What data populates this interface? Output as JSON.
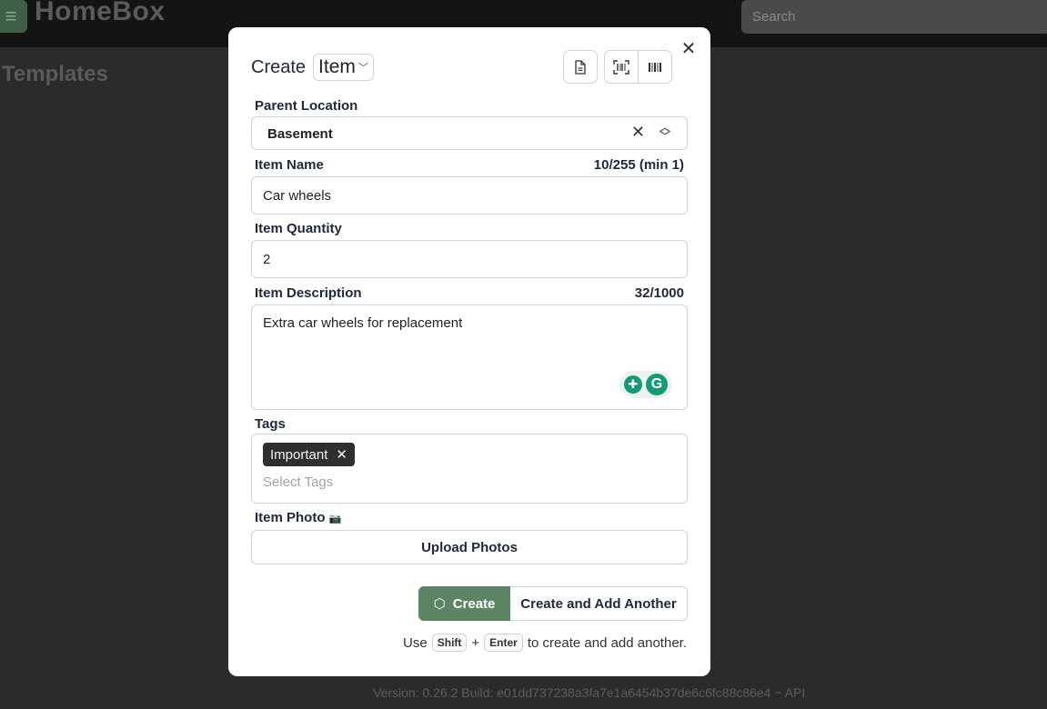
{
  "app": {
    "logo": "HomeBox",
    "search_placeholder": "Search",
    "page_title": "Templates",
    "version": "Version: 0.26.2 Build: e01dd737238a3fa7e1a6454b37de6c6fc88c86e4 ~ API"
  },
  "modal": {
    "title": "Create",
    "type_value": "Item",
    "parent_location": {
      "label": "Parent Location",
      "value": "Basement"
    },
    "item_name": {
      "label": "Item Name",
      "value": "Car wheels",
      "counter": "10/255 (min 1)"
    },
    "item_quantity": {
      "label": "Item Quantity",
      "value": "2"
    },
    "item_description": {
      "label": "Item Description",
      "value": "Extra car wheels for replacement",
      "counter": "32/1000"
    },
    "tags": {
      "label": "Tags",
      "selected": [
        "Important"
      ],
      "placeholder": "Select Tags"
    },
    "item_photo": {
      "label": "Item Photo",
      "upload_label": "Upload Photos"
    },
    "create_label": "Create",
    "create_another_label": "Create and Add Another",
    "hint": {
      "prefix": "Use",
      "key1": "Shift",
      "plus": "+",
      "key2": "Enter",
      "suffix": "to create and add another."
    }
  },
  "colors": {
    "primary": "#5e8466",
    "overlay": "#2b2b2b",
    "tag_bg": "#2f2f2f",
    "grammarly": "#159a78"
  },
  "icons": [
    "menu-icon",
    "close-icon",
    "document-icon",
    "scan-icon",
    "barcode-icon",
    "clear-icon",
    "chevron-up-down-icon",
    "cube-icon",
    "camera-icon"
  ]
}
